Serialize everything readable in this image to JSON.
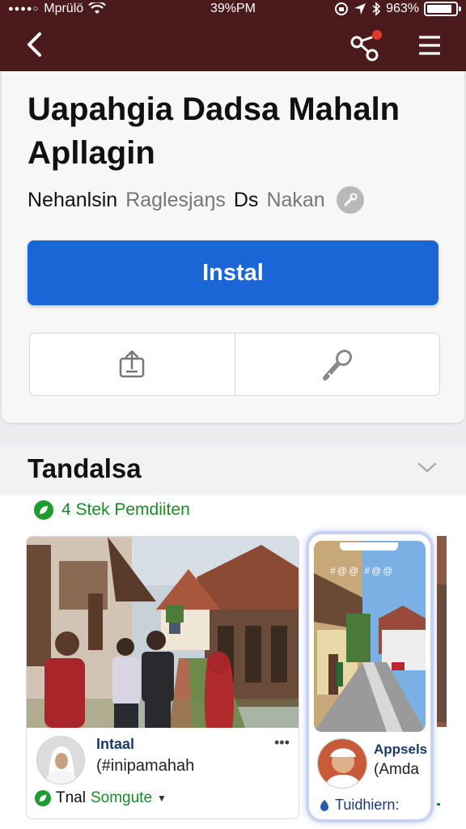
{
  "status_bar": {
    "carrier": "Mprülö",
    "time": "39%PM",
    "battery_percent": "963%"
  },
  "nav": {
    "back_icon": "chevron-left-icon",
    "share_icon": "share-icon",
    "menu_icon": "hamburger-menu-icon"
  },
  "app": {
    "title": "Uapahgia Dadsa Mahaln Apllagin",
    "developer_parts": [
      "Nehanlsin",
      "Raglesjaŋs",
      "Ds",
      "Nakan"
    ],
    "install_label": "Instal",
    "action_icons": [
      "share-upload-icon",
      "wrench-icon"
    ]
  },
  "section": {
    "title": "Tandalsa",
    "stats": "4  Stek Pemdiiten"
  },
  "posts": [
    {
      "name": "Intaal",
      "handle": "(#inipamahah",
      "meta_prefix": "Tnal",
      "meta_green": "Somgute",
      "more": "•••"
    },
    {
      "phone_text": "#@@ #@@",
      "name": "Appsels",
      "handle": "(Amda",
      "meta": "Tuidhiern:"
    }
  ],
  "colors": {
    "header": "#4a1a1c",
    "install_button": "#1a66d6",
    "accent_green": "#1a8a2a",
    "notification_dot": "#e03a2a"
  }
}
